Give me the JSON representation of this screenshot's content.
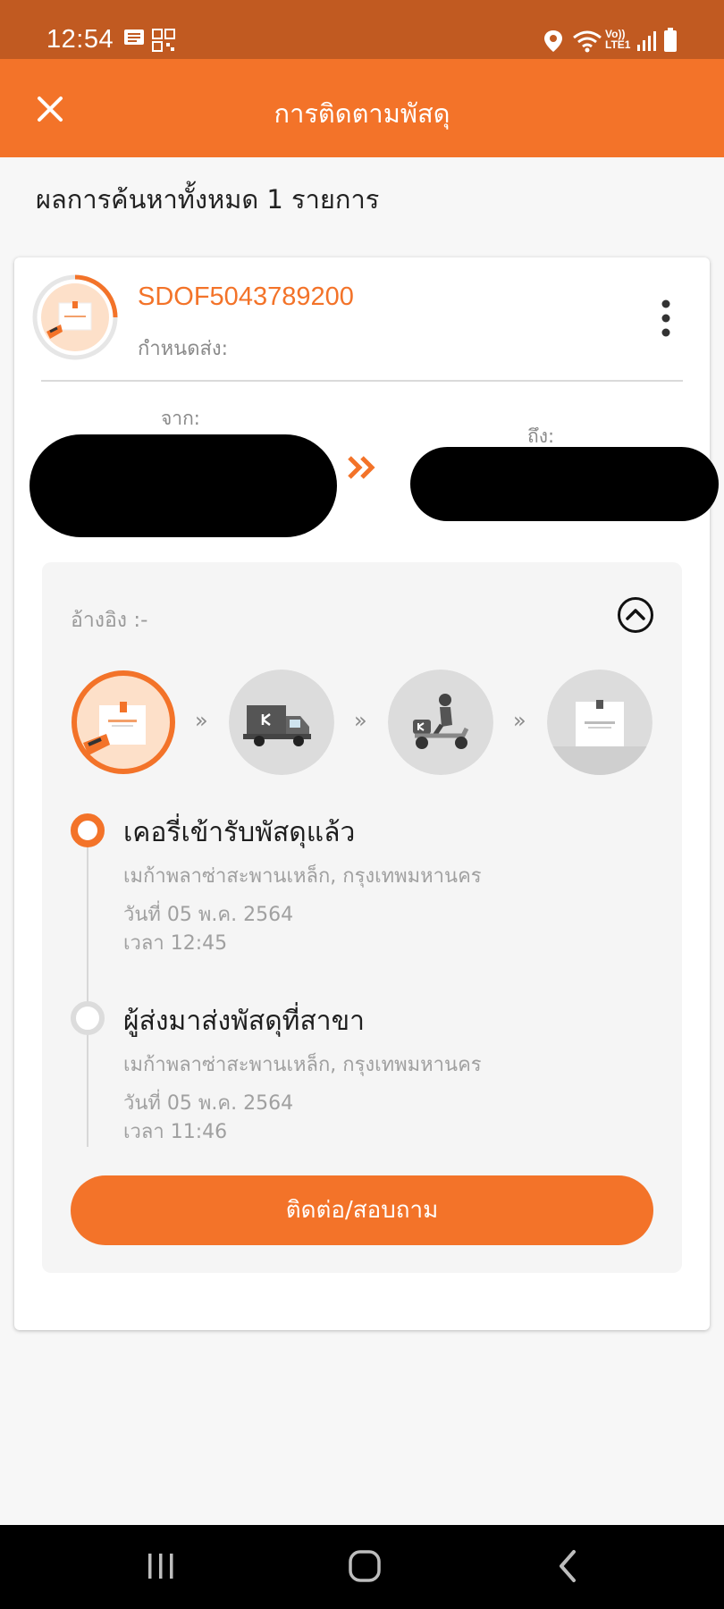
{
  "status_bar": {
    "time": "12:54",
    "icons": [
      "message-icon",
      "qr-icon",
      "location-icon",
      "wifi-icon",
      "volte-icon",
      "signal-icon",
      "battery-icon"
    ],
    "volte_text": "Vo))",
    "lte_text": "LTE1"
  },
  "app_bar": {
    "title": "การติดตามพัสดุ",
    "close_icon": "close-icon"
  },
  "results": {
    "count_text": "ผลการค้นหาทั้งหมด 1 รายการ"
  },
  "shipment": {
    "tracking_number": "SDOF5043789200",
    "due_label": "กำหนดส่ง:",
    "from_label": "จาก:",
    "to_label": "ถึง:",
    "reference_label": "อ้างอิง :-",
    "progress": 0.25
  },
  "steps": [
    {
      "name": "picked-up",
      "icon": "parcel-hand-icon",
      "active": true
    },
    {
      "name": "in-transit",
      "icon": "truck-icon",
      "active": false
    },
    {
      "name": "out-for-delivery",
      "icon": "scooter-icon",
      "active": false
    },
    {
      "name": "delivered",
      "icon": "parcel-box-icon",
      "active": false
    }
  ],
  "timeline": [
    {
      "title": "เคอรี่เข้ารับพัสดุแล้ว",
      "location": "เมก้าพลาซ่าสะพานเหล็ก, กรุงเทพมหานคร",
      "date": "วันที่ 05 พ.ค. 2564",
      "time": "เวลา 12:45"
    },
    {
      "title": "ผู้ส่งมาส่งพัสดุที่สาขา",
      "location": "เมก้าพลาซ่าสะพานเหล็ก, กรุงเทพมหานคร",
      "date": "วันที่ 05 พ.ค. 2564",
      "time": "เวลา 11:46"
    }
  ],
  "contact_button": "ติดต่อ/สอบถาม",
  "colors": {
    "accent": "#f37329",
    "status_bar": "#c15a21"
  }
}
